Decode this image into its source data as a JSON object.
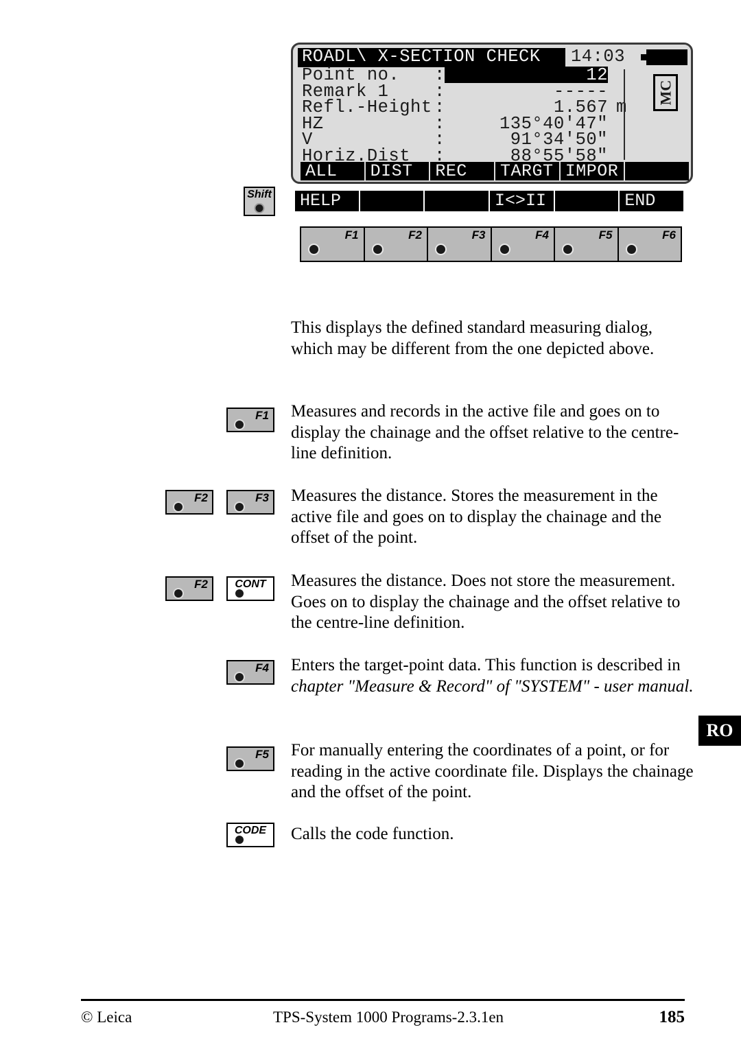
{
  "device": {
    "screen": {
      "title": "ROADL\\ X-SECTION CHECK",
      "time": "14:03",
      "battery_icon": "battery-full-icon",
      "mode_badge": "MC",
      "rows": [
        {
          "label": "Point no.",
          "colon": ":",
          "value": "12",
          "unit": "",
          "highlighted": true
        },
        {
          "label": "Remark 1",
          "colon": ":",
          "value": "-----",
          "unit": "",
          "highlighted": false
        },
        {
          "label": "Refl.-Height",
          "colon": ":",
          "value": "1.567",
          "unit": "m",
          "highlighted": false
        },
        {
          "label": "HZ",
          "colon": ":",
          "value": "135°40'47\"",
          "unit": "",
          "highlighted": false
        },
        {
          "label": "V",
          "colon": ":",
          "value": "91°34'50\"",
          "unit": "",
          "highlighted": false
        },
        {
          "label": "Horiz.Dist",
          "colon": ":",
          "value": "88°55'58\"",
          "unit": "",
          "highlighted": false
        }
      ],
      "softkeys": [
        "ALL",
        "DIST",
        "REC",
        "TARGT",
        "IMPOR",
        ""
      ],
      "shift_softkeys": [
        "HELP",
        "",
        "",
        "I<>II",
        "",
        "END"
      ]
    },
    "shift_key": {
      "label": "Shift"
    },
    "function_keys": [
      "F1",
      "F2",
      "F3",
      "F4",
      "F5",
      "F6"
    ]
  },
  "intro": "This displays the defined standard measuring dialog, which may be different from the one depicted above.",
  "entries": [
    {
      "keys": [
        {
          "label": "F1",
          "style": "grey"
        }
      ],
      "text": "Measures and records in the active file and goes on to display the chainage and the offset relative to the centre-line definition."
    },
    {
      "keys": [
        {
          "label": "F2",
          "style": "grey"
        },
        {
          "label": "F3",
          "style": "grey"
        }
      ],
      "text": "Measures the distance. Stores the measurement in the active file and goes on to display the chainage and the offset of the point."
    },
    {
      "keys": [
        {
          "label": "F2",
          "style": "grey"
        },
        {
          "label": "CONT",
          "style": "white"
        }
      ],
      "text": "Measures the distance. Does not store the measurement. Goes on to display the chainage and the offset relative to the centre-line definition."
    },
    {
      "keys": [
        {
          "label": "F4",
          "style": "grey"
        }
      ],
      "text_prefix": "Enters the target-point data. This function is described in ",
      "text_italic": "chapter \"Measure & Record\" of \"SYSTEM\" - user manual.",
      "text": ""
    },
    {
      "keys": [
        {
          "label": "F5",
          "style": "grey"
        }
      ],
      "text": "For manually entering the coordinates of a point, or for reading in the active coordinate file. Displays the chainage and the offset of the point."
    },
    {
      "keys": [
        {
          "label": "CODE",
          "style": "white"
        }
      ],
      "text": "Calls the code function."
    }
  ],
  "side_tab": {
    "label": "RO"
  },
  "footer": {
    "left": "© Leica",
    "middle": "TPS-System 1000 Programs-2.3.1en",
    "page": "185"
  }
}
